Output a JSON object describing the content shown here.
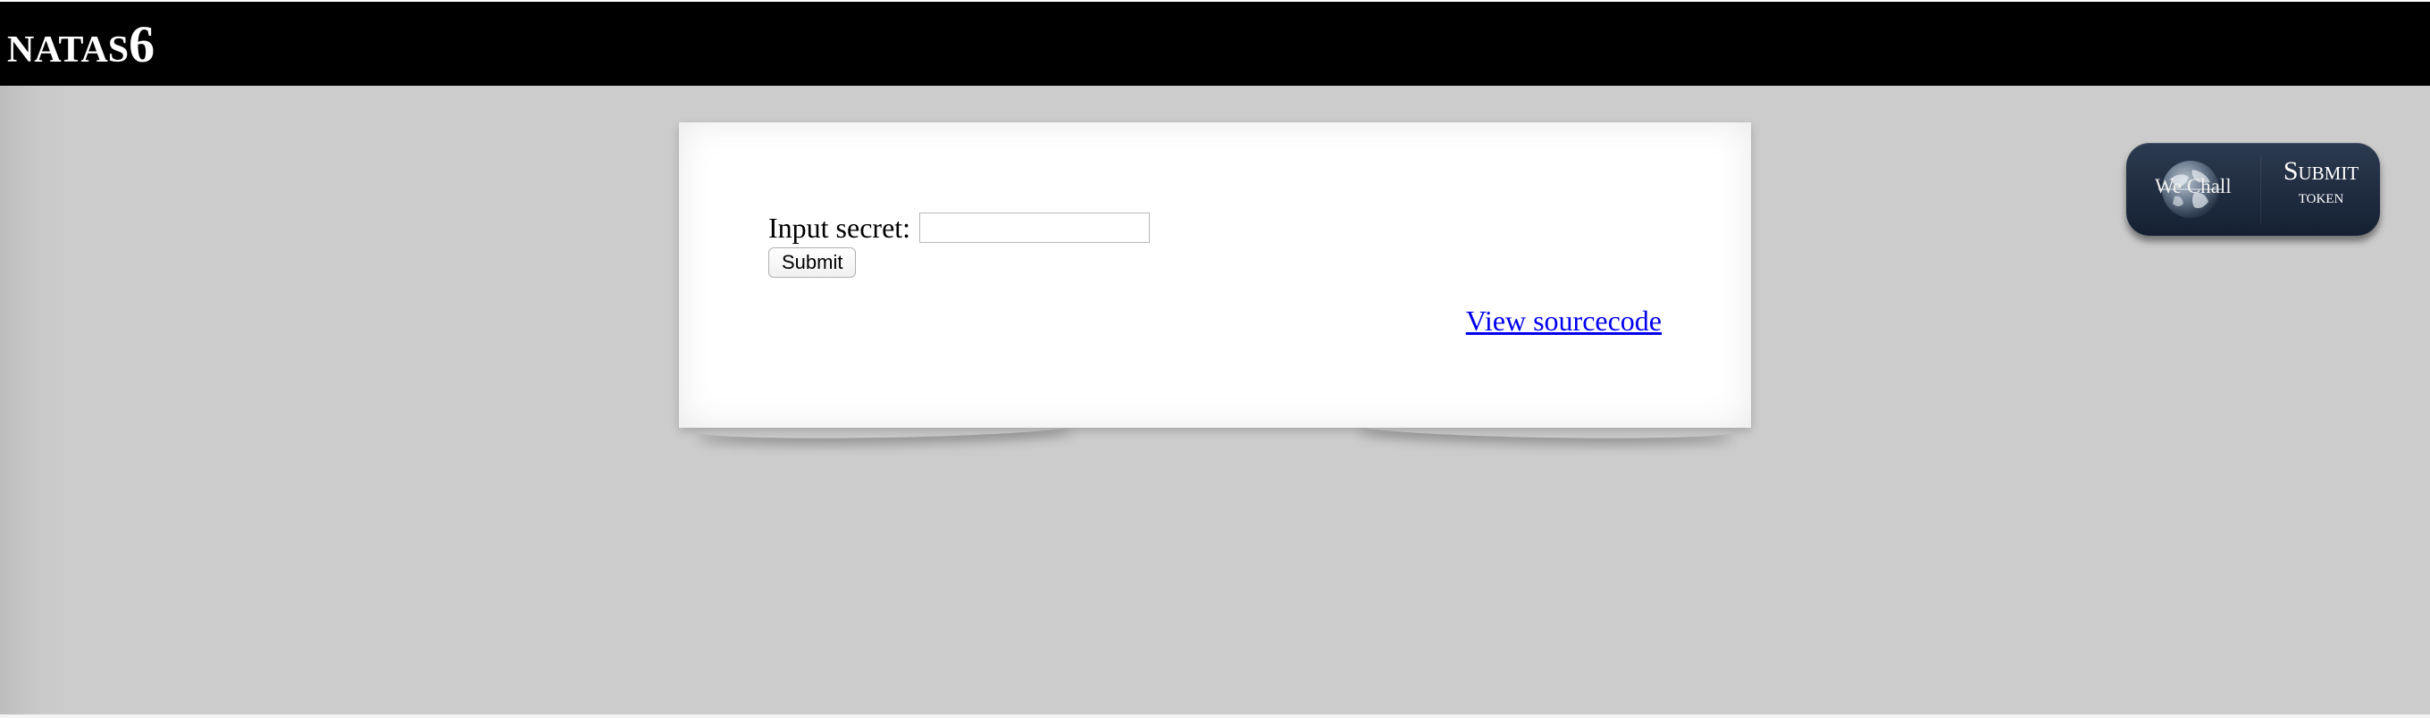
{
  "header": {
    "title_main": "NATAS",
    "title_number": "6"
  },
  "form": {
    "label": "Input secret:",
    "input_value": "",
    "submit_label": "Submit"
  },
  "links": {
    "view_source": "View sourcecode"
  },
  "wechall": {
    "brand": "We Chall",
    "action_line1": "Submit",
    "action_line2": "token",
    "icon": "globe-icon"
  },
  "colors": {
    "header_bg": "#000000",
    "page_bg": "#cccccc",
    "card_bg": "#ffffff",
    "link": "#0000ee",
    "wechall_bg": "#1c283a"
  }
}
